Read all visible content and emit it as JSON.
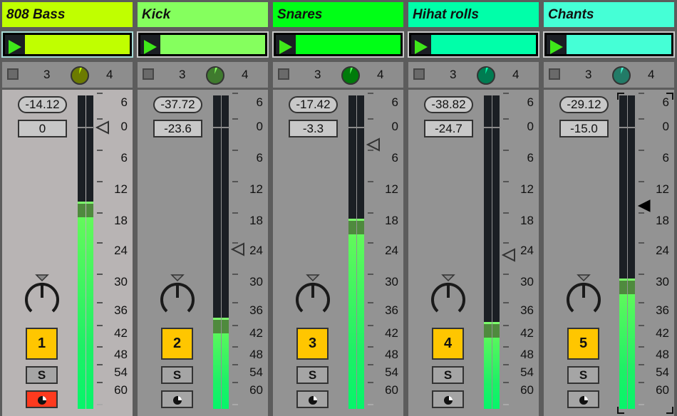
{
  "mixer": {
    "scale": {
      "labels": [
        "6",
        "0",
        "6",
        "12",
        "18",
        "24",
        "30",
        "36",
        "42",
        "48",
        "54",
        "60"
      ],
      "db_values": [
        6,
        0,
        -6,
        -12,
        -18,
        -24,
        -30,
        -36,
        -42,
        -48,
        -54,
        -60
      ]
    },
    "tracks": [
      {
        "name": "808 Bass",
        "color": "#c0ff00",
        "knob_color": "#6c7b00",
        "knob_tick_color": "#c0ff00",
        "clip_selected": true,
        "send_a": "3",
        "send_b": "4",
        "peak": "-14.12",
        "volume": "0",
        "volume_db": 0,
        "meter_db": -14.12,
        "number": "1",
        "solo_label": "S",
        "monitor_active": true,
        "strip_selected": true,
        "fader_filled": false
      },
      {
        "name": "Kick",
        "color": "#85ff5e",
        "knob_color": "#3f7a2e",
        "knob_tick_color": "#85ff5e",
        "clip_selected": false,
        "send_a": "3",
        "send_b": "4",
        "peak": "-37.72",
        "volume": "-23.6",
        "volume_db": -23.6,
        "meter_db": -37.72,
        "number": "2",
        "solo_label": "S",
        "monitor_active": false,
        "strip_selected": false,
        "fader_filled": false
      },
      {
        "name": "Snares",
        "color": "#00ff16",
        "knob_color": "#007b0b",
        "knob_tick_color": "#5aff5a",
        "clip_selected": false,
        "send_a": "3",
        "send_b": "4",
        "peak": "-17.42",
        "volume": "-3.3",
        "volume_db": -3.3,
        "meter_db": -17.42,
        "number": "3",
        "solo_label": "S",
        "monitor_active": false,
        "strip_selected": false,
        "fader_filled": false
      },
      {
        "name": "Hihat rolls",
        "color": "#00ffa9",
        "knob_color": "#007b51",
        "knob_tick_color": "#00ffa9",
        "clip_selected": false,
        "send_a": "3",
        "send_b": "4",
        "peak": "-38.82",
        "volume": "-24.7",
        "volume_db": -24.7,
        "meter_db": -38.82,
        "number": "4",
        "solo_label": "S",
        "monitor_active": false,
        "strip_selected": false,
        "fader_filled": false
      },
      {
        "name": "Chants",
        "color": "#45ffd6",
        "knob_color": "#227b67",
        "knob_tick_color": "#45ffd6",
        "clip_selected": false,
        "send_a": "3",
        "send_b": "4",
        "peak": "-29.12",
        "volume": "-15.0",
        "volume_db": -15.0,
        "meter_db": -29.12,
        "number": "5",
        "solo_label": "S",
        "monitor_active": false,
        "strip_selected": false,
        "fader_filled": true,
        "focused": true
      }
    ]
  }
}
